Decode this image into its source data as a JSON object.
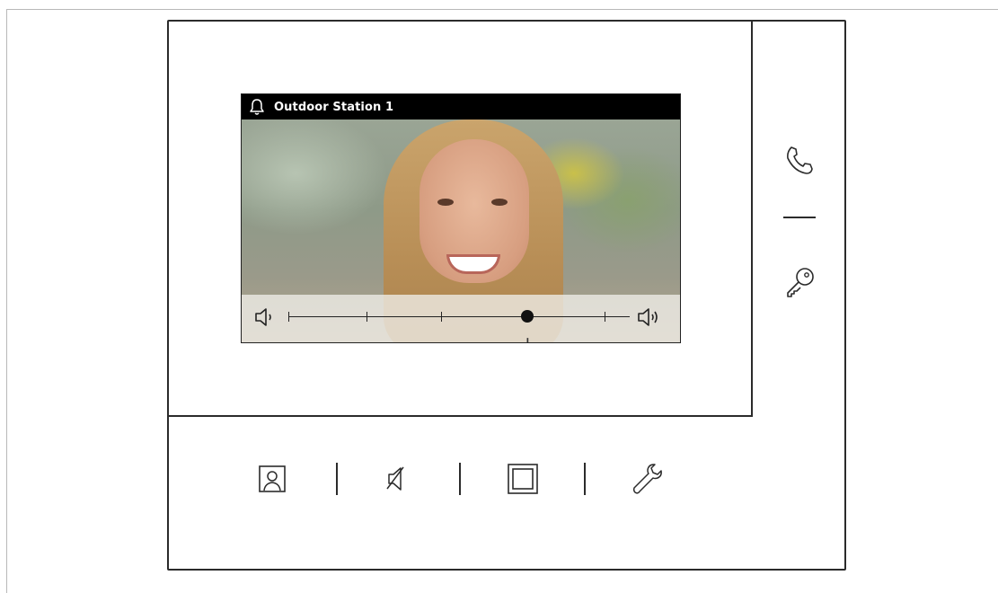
{
  "screen": {
    "status": {
      "title": "Outdoor Station 1",
      "icon": "bell-icon"
    },
    "volume": {
      "minus_label": "−",
      "plus_label": "+",
      "level": 0.7,
      "icons": [
        "speaker-low-icon",
        "speaker-high-icon"
      ]
    }
  },
  "side_buttons": [
    "phone-icon",
    "key-icon"
  ],
  "bottom_buttons": [
    "contact-icon",
    "mute-icon",
    "window-icon",
    "wrench-icon"
  ],
  "colors": {
    "frame": "#2b2b2b",
    "status_bar": "#000000",
    "status_text": "#ffffff"
  }
}
